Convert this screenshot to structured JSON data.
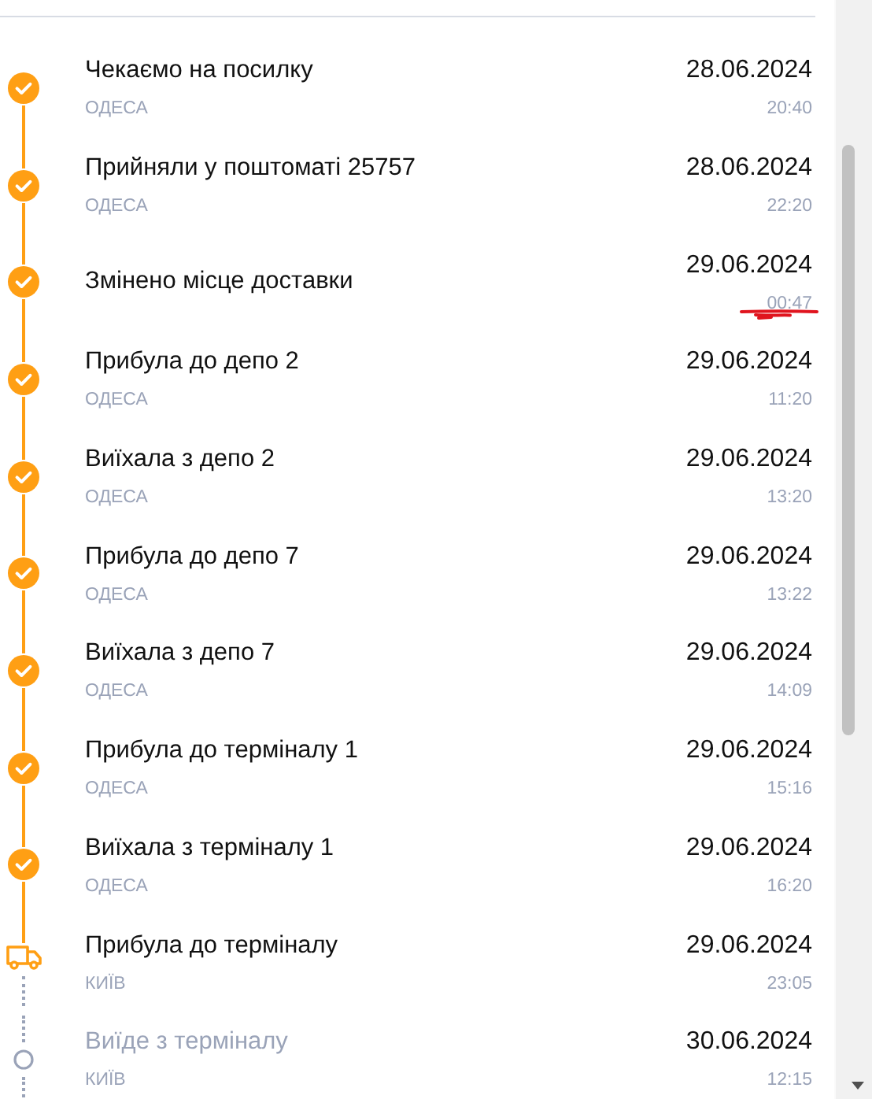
{
  "events": [
    {
      "kind": "done",
      "title": "Чекаємо на посилку",
      "city": "ОДЕСА",
      "date": "28.06.2024",
      "time": "20:40",
      "underlined": false
    },
    {
      "kind": "done",
      "title": "Прийняли у поштоматі 25757",
      "city": "ОДЕСА",
      "date": "28.06.2024",
      "time": "22:20",
      "underlined": false
    },
    {
      "kind": "done",
      "title": "Змінено місце доставки",
      "date": "29.06.2024",
      "time": "00:47",
      "underlined": true
    },
    {
      "kind": "done",
      "title": "Прибула до депо 2",
      "city": "ОДЕСА",
      "date": "29.06.2024",
      "time": "11:20",
      "underlined": false
    },
    {
      "kind": "done",
      "title": "Виїхала з депо 2",
      "city": "ОДЕСА",
      "date": "29.06.2024",
      "time": "13:20",
      "underlined": false
    },
    {
      "kind": "done",
      "title": "Прибула до депо 7",
      "city": "ОДЕСА",
      "date": "29.06.2024",
      "time": "13:22",
      "underlined": false
    },
    {
      "kind": "done",
      "title": "Виїхала з депо 7",
      "city": "ОДЕСА",
      "date": "29.06.2024",
      "time": "14:09",
      "underlined": false
    },
    {
      "kind": "done",
      "title": "Прибула до терміналу 1",
      "city": "ОДЕСА",
      "date": "29.06.2024",
      "time": "15:16",
      "underlined": false
    },
    {
      "kind": "done",
      "title": "Виїхала з терміналу 1",
      "city": "ОДЕСА",
      "date": "29.06.2024",
      "time": "16:20",
      "underlined": false
    },
    {
      "kind": "current",
      "title": "Прибула до терміналу",
      "city": "КИЇВ",
      "date": "29.06.2024",
      "time": "23:05",
      "underlined": false
    },
    {
      "kind": "pending",
      "title": "Виїде з терміналу",
      "city": "КИЇВ",
      "date": "30.06.2024",
      "time": "12:15",
      "underlined": false
    }
  ]
}
